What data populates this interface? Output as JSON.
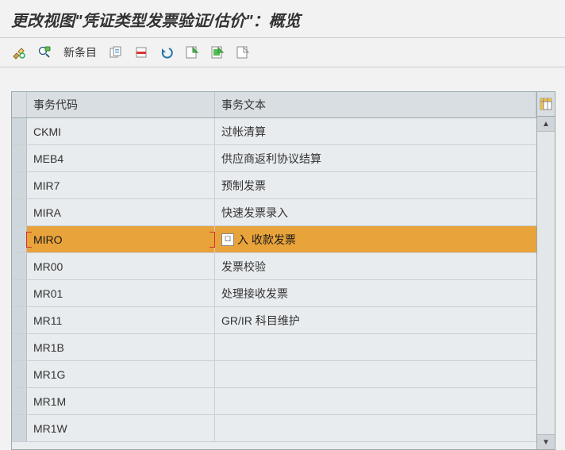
{
  "title": "更改视图\"凭证类型发票验证/估价\"：概览",
  "toolbar": {
    "new_entry_label": "新条目"
  },
  "table": {
    "headers": {
      "code": "事务代码",
      "text": "事务文本"
    },
    "selected_index": 4,
    "rows": [
      {
        "code": "CKMI",
        "text": "过帐清算"
      },
      {
        "code": "MEB4",
        "text": "供应商返利协议结算"
      },
      {
        "code": "MIR7",
        "text": "预制发票"
      },
      {
        "code": "MIRA",
        "text": "快速发票录入"
      },
      {
        "code": "MIRO",
        "text": "入 收款发票",
        "has_match_help": true
      },
      {
        "code": "MR00",
        "text": "发票校验"
      },
      {
        "code": "MR01",
        "text": "处理接收发票"
      },
      {
        "code": "MR11",
        "text": "GR/IR 科目维护"
      },
      {
        "code": "MR1B",
        "text": ""
      },
      {
        "code": "MR1G",
        "text": ""
      },
      {
        "code": "MR1M",
        "text": ""
      },
      {
        "code": "MR1W",
        "text": ""
      }
    ]
  }
}
